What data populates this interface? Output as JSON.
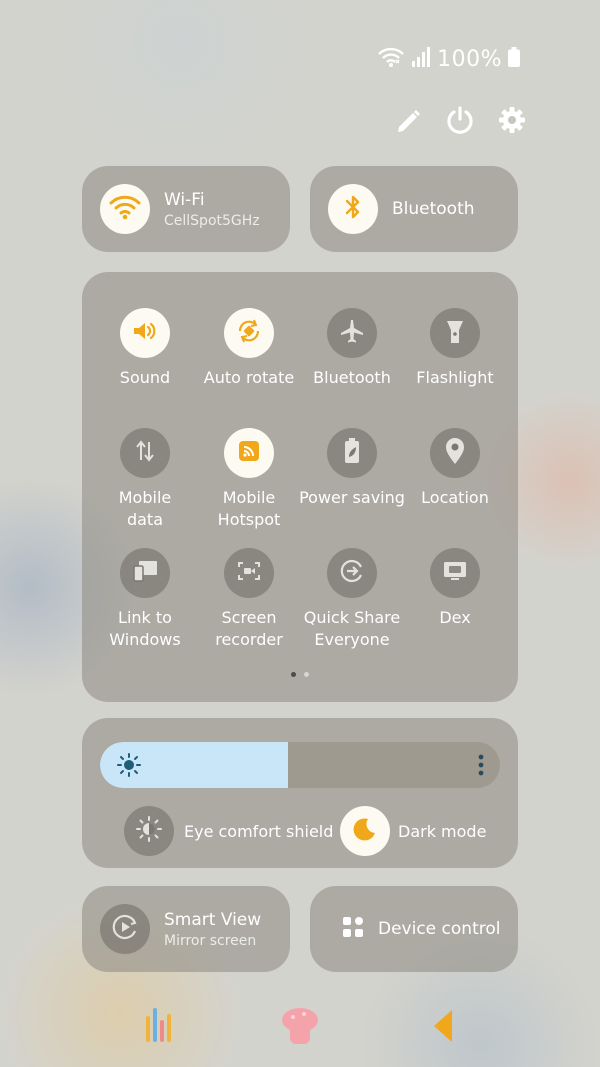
{
  "status_bar": {
    "battery": "100%"
  },
  "top_actions": {
    "edit_icon": "pencil-icon",
    "power_icon": "power-icon",
    "settings_icon": "gear-icon"
  },
  "wifi": {
    "title": "Wi-Fi",
    "subtitle": "CellSpot5GHz",
    "on": true
  },
  "bluetooth_big": {
    "title": "Bluetooth",
    "on": true
  },
  "grid": [
    {
      "label": "Sound",
      "icon": "speaker-icon",
      "on": true
    },
    {
      "label": "Auto rotate",
      "icon": "rotate-icon",
      "on": true
    },
    {
      "label": "Bluetooth",
      "icon": "airplane-icon",
      "on": false
    },
    {
      "label": "Flashlight",
      "icon": "flashlight-icon",
      "on": false
    },
    {
      "label": "Mobile\ndata",
      "icon": "data-arrows-icon",
      "on": false
    },
    {
      "label": "Mobile\nHotspot",
      "icon": "hotspot-icon",
      "on": true
    },
    {
      "label": "Power saving",
      "icon": "battery-leaf-icon",
      "on": false
    },
    {
      "label": "Location",
      "icon": "location-pin-icon",
      "on": false
    },
    {
      "label": "Link to\nWindows",
      "icon": "link-windows-icon",
      "on": false
    },
    {
      "label": "Screen\nrecorder",
      "icon": "screen-recorder-icon",
      "on": false
    },
    {
      "label": "Quick Share\nEveryone",
      "icon": "quick-share-icon",
      "on": false
    },
    {
      "label": "Dex",
      "icon": "dex-icon",
      "on": false
    }
  ],
  "brightness": {
    "level": 0.47,
    "menu_icon": "more-vertical-icon"
  },
  "eye_comfort": {
    "label": "Eye comfort shield",
    "on": false
  },
  "dark_mode": {
    "label": "Dark mode",
    "on": true
  },
  "smart_view": {
    "title": "Smart View",
    "subtitle": "Mirror screen"
  },
  "device_control": {
    "title": "Device control"
  },
  "nav": {
    "recents": "recents-icon",
    "home": "home-icon",
    "back": "back-icon"
  },
  "colors": {
    "accent": "#f0a81a",
    "tile_on": "#fdfaf1",
    "slider_fill": "#c9e5f8",
    "dark_icon": "#1f5e77"
  }
}
